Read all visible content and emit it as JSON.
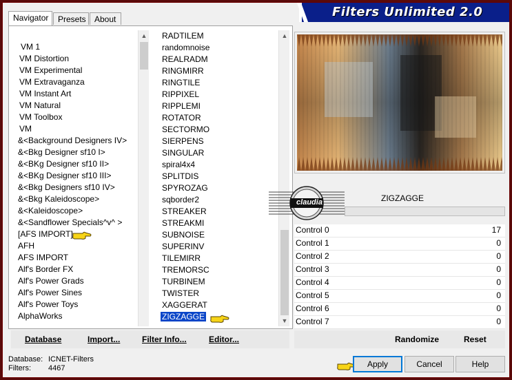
{
  "window": {
    "title": "Filters Unlimited 2.0"
  },
  "tabs": [
    {
      "label": "Navigator",
      "active": true
    },
    {
      "label": "Presets",
      "active": false
    },
    {
      "label": "About",
      "active": false
    }
  ],
  "categories": {
    "items": [
      "VM 1",
      "VM Distortion",
      "VM Experimental",
      "VM Extravaganza",
      "VM Instant Art",
      "VM Natural",
      "VM Toolbox",
      "VM",
      "&<Background Designers IV>",
      "&<Bkg Designer sf10 I>",
      "&<BKg Designer sf10 II>",
      "&<BKg Designer sf10 III>",
      "&<Bkg Designers sf10 IV>",
      "&<Bkg Kaleidoscope>",
      "&<Kaleidoscope>",
      "&<Sandflower Specials^v^ >",
      "[AFS IMPORT]",
      "AFH",
      "AFS IMPORT",
      "Alf's Border FX",
      "Alf's Power Grads",
      "Alf's Power Sines",
      "Alf's Power Toys",
      "AlphaWorks"
    ],
    "highlighted": "[AFS IMPORT]"
  },
  "filters": {
    "items": [
      "RADTILEM",
      "randomnoise",
      "REALRADM",
      "RINGMIRR",
      "RINGTILE",
      "RIPPIXEL",
      "RIPPLEMI",
      "ROTATOR",
      "SECTORMO",
      "SIERPENS",
      "SINGULAR",
      "spiral4x4",
      "SPLITDIS",
      "SPYROZAG",
      "sqborder2",
      "STREAKER",
      "STREAKMI",
      "SUBNOISE",
      "SUPERINV",
      "TILEMIRR",
      "TREMORSC",
      "TURBINEM",
      "TWISTER",
      "XAGGERAT",
      "ZIGZAGGE"
    ],
    "selected": "ZIGZAGGE"
  },
  "left_buttons": {
    "database": "Database",
    "import": "Import...",
    "filter_info": "Filter Info...",
    "editor": "Editor..."
  },
  "preview": {
    "filter_name": "ZIGZAGGE",
    "watermark": "claudia",
    "progress": 0
  },
  "controls": [
    {
      "label": "Control 0",
      "value": "17"
    },
    {
      "label": "Control 1",
      "value": "0"
    },
    {
      "label": "Control 2",
      "value": "0"
    },
    {
      "label": "Control 3",
      "value": "0"
    },
    {
      "label": "Control 4",
      "value": "0"
    },
    {
      "label": "Control 5",
      "value": "0"
    },
    {
      "label": "Control 6",
      "value": "0"
    },
    {
      "label": "Control 7",
      "value": "0"
    }
  ],
  "control_buttons": {
    "randomize": "Randomize",
    "reset": "Reset"
  },
  "status": {
    "database_label": "Database:",
    "database_value": "ICNET-Filters",
    "filters_label": "Filters:",
    "filters_value": "4467"
  },
  "dialog_buttons": {
    "apply": "Apply",
    "cancel": "Cancel",
    "help": "Help"
  },
  "colors": {
    "title_bar": "#0a1f8a",
    "selection": "#0a46c8",
    "frame": "#5a0a0a"
  }
}
